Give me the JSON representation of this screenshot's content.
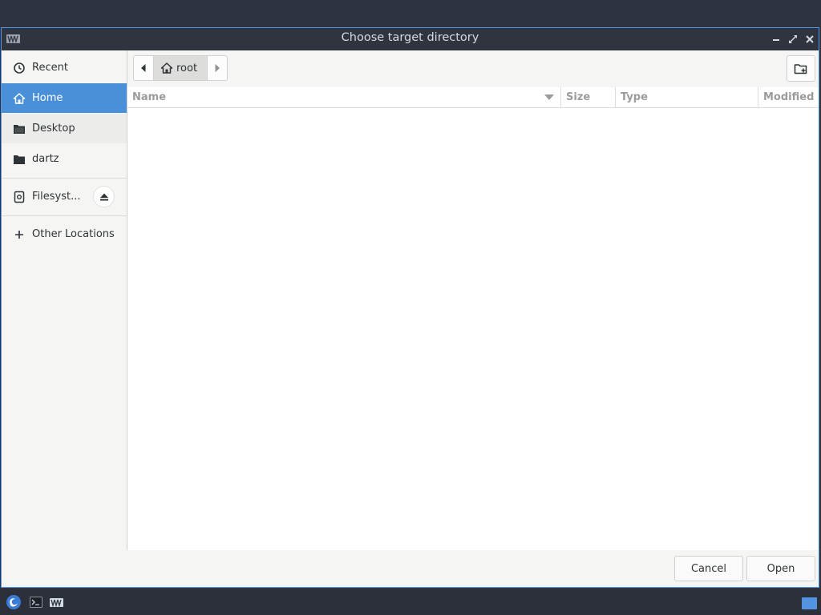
{
  "window": {
    "title": "Choose target directory"
  },
  "sidebar": {
    "items": [
      {
        "label": "Recent",
        "icon": "clock-icon"
      },
      {
        "label": "Home",
        "icon": "home-icon",
        "selected": true
      },
      {
        "label": "Desktop",
        "icon": "folder-icon"
      },
      {
        "label": "dartz",
        "icon": "folder-icon"
      },
      {
        "label": "Filesyst...",
        "icon": "drive-icon"
      },
      {
        "label": "Other Locations",
        "icon": "plus-icon"
      }
    ]
  },
  "pathbar": {
    "crumb": "root"
  },
  "columns": {
    "name": "Name",
    "size": "Size",
    "type": "Type",
    "modified": "Modified"
  },
  "buttons": {
    "cancel": "Cancel",
    "open": "Open"
  },
  "colors": {
    "accent": "#4a90d9",
    "titlebar": "#2f343f",
    "taskbar": "#2b303b"
  }
}
